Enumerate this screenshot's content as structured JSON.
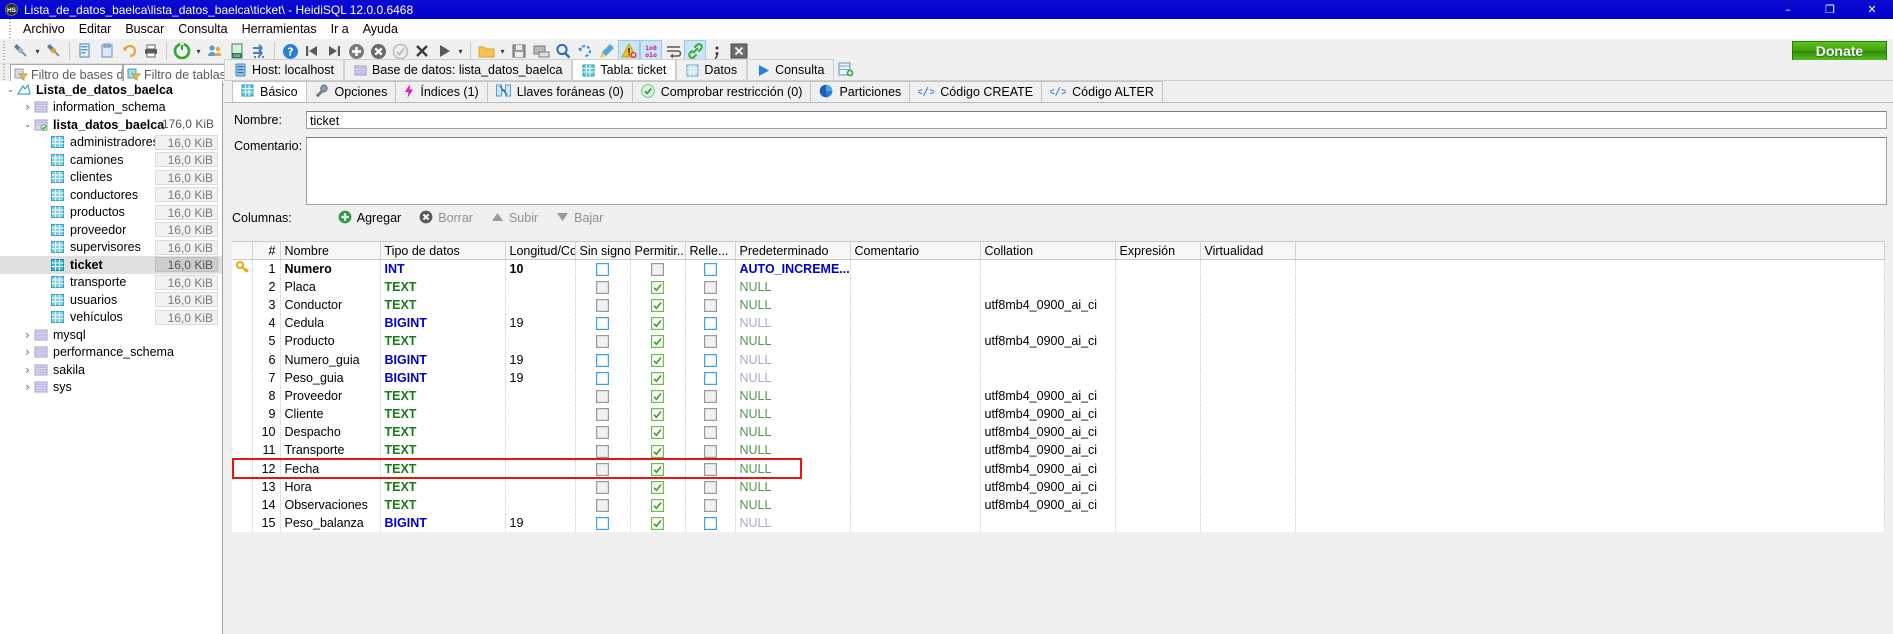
{
  "window": {
    "title": "Lista_de_datos_baelca\\lista_datos_baelca\\ticket\\ - HeidiSQL 12.0.0.6468",
    "logo": "HS",
    "minimize": "–",
    "maximize": "❐",
    "close": "✕"
  },
  "menu": [
    "Archivo",
    "Editar",
    "Buscar",
    "Consulta",
    "Herramientas",
    "Ir a",
    "Ayuda"
  ],
  "toolbar": {
    "donate_label": "Donate",
    "icons": [
      "connect-icon",
      "connect-dropdown-icon",
      "disconnect-icon",
      "new-query-tab-icon",
      "paste-icon",
      "undo-icon",
      "print-icon",
      "refresh-icon",
      "refresh-dropdown-icon",
      "user-manager-icon",
      "export-csv-icon",
      "import-icon",
      "help-icon",
      "first-row-icon",
      "last-row-icon",
      "insert-row-icon",
      "delete-row-icon",
      "commit-icon",
      "cancel-icon",
      "run-query-icon",
      "run-dropdown-icon",
      "open-folder-icon",
      "open-dropdown-icon",
      "save-icon",
      "save-as-icon",
      "find-icon",
      "replace-icon",
      "clear-filter-icon",
      "warning-icon",
      "binary-icon",
      "wrap-icon",
      "link-icon",
      "semicolon-icon",
      "close-tab-icon"
    ]
  },
  "filters": {
    "db_filter_placeholder": "Filtro de bases de datos",
    "table_filter_placeholder": "Filtro de tablas",
    "db_filter_value": "",
    "table_filter_value": ""
  },
  "main_tabs": [
    {
      "label": "Host: localhost",
      "icon": "server-icon",
      "active": false
    },
    {
      "label": "Base de datos: lista_datos_baelca",
      "icon": "database-icon",
      "active": false
    },
    {
      "label": "Tabla: ticket",
      "icon": "table-icon",
      "active": true
    },
    {
      "label": "Datos",
      "icon": "grid-icon",
      "active": false
    },
    {
      "label": "Consulta",
      "icon": "play-icon",
      "active": false
    }
  ],
  "sidebar": {
    "items": [
      {
        "label": "Lista_de_datos_baelca",
        "icon": "session-icon",
        "indent": 0,
        "expander": "down",
        "bold": true,
        "size": "",
        "selected": false
      },
      {
        "label": "information_schema",
        "icon": "db-icon",
        "indent": 1,
        "expander": "right",
        "bold": false,
        "size": "",
        "selected": false
      },
      {
        "label": "lista_datos_baelca",
        "icon": "db-active-icon",
        "indent": 1,
        "expander": "down",
        "bold": true,
        "size": "176,0 KiB",
        "size_plain": true,
        "selected": false
      },
      {
        "label": "administradores",
        "icon": "table-icon",
        "indent": 2,
        "expander": "",
        "bold": false,
        "size": "16,0 KiB",
        "selected": false
      },
      {
        "label": "camiones",
        "icon": "table-icon",
        "indent": 2,
        "expander": "",
        "bold": false,
        "size": "16,0 KiB",
        "selected": false
      },
      {
        "label": "clientes",
        "icon": "table-icon",
        "indent": 2,
        "expander": "",
        "bold": false,
        "size": "16,0 KiB",
        "selected": false
      },
      {
        "label": "conductores",
        "icon": "table-icon",
        "indent": 2,
        "expander": "",
        "bold": false,
        "size": "16,0 KiB",
        "selected": false
      },
      {
        "label": "productos",
        "icon": "table-icon",
        "indent": 2,
        "expander": "",
        "bold": false,
        "size": "16,0 KiB",
        "selected": false
      },
      {
        "label": "proveedor",
        "icon": "table-icon",
        "indent": 2,
        "expander": "",
        "bold": false,
        "size": "16,0 KiB",
        "selected": false
      },
      {
        "label": "supervisores",
        "icon": "table-icon",
        "indent": 2,
        "expander": "",
        "bold": false,
        "size": "16,0 KiB",
        "selected": false
      },
      {
        "label": "ticket",
        "icon": "table-icon",
        "indent": 2,
        "expander": "",
        "bold": true,
        "size": "16,0 KiB",
        "selected": true
      },
      {
        "label": "transporte",
        "icon": "table-icon",
        "indent": 2,
        "expander": "",
        "bold": false,
        "size": "16,0 KiB",
        "selected": false
      },
      {
        "label": "usuarios",
        "icon": "table-icon",
        "indent": 2,
        "expander": "",
        "bold": false,
        "size": "16,0 KiB",
        "selected": false
      },
      {
        "label": "vehículos",
        "icon": "table-icon",
        "indent": 2,
        "expander": "",
        "bold": false,
        "size": "16,0 KiB",
        "selected": false
      },
      {
        "label": "mysql",
        "icon": "db-icon",
        "indent": 1,
        "expander": "right",
        "bold": false,
        "size": "",
        "selected": false
      },
      {
        "label": "performance_schema",
        "icon": "db-icon",
        "indent": 1,
        "expander": "right",
        "bold": false,
        "size": "",
        "selected": false
      },
      {
        "label": "sakila",
        "icon": "db-icon",
        "indent": 1,
        "expander": "right",
        "bold": false,
        "size": "",
        "selected": false
      },
      {
        "label": "sys",
        "icon": "db-icon",
        "indent": 1,
        "expander": "right",
        "bold": false,
        "size": "",
        "selected": false
      }
    ]
  },
  "sub_tabs": [
    {
      "label": "Básico",
      "icon": "table-grid-icon",
      "active": true
    },
    {
      "label": "Opciones",
      "icon": "wrench-icon",
      "active": false
    },
    {
      "label": "Índices (1)",
      "icon": "lightning-icon",
      "active": false
    },
    {
      "label": "Llaves foráneas (0)",
      "icon": "foreign-key-icon",
      "active": false
    },
    {
      "label": "Comprobar restricción (0)",
      "icon": "check-circle-icon",
      "active": false
    },
    {
      "label": "Particiones",
      "icon": "pie-chart-icon",
      "active": false
    },
    {
      "label": "Código CREATE",
      "icon": "code-icon",
      "active": false
    },
    {
      "label": "Código ALTER",
      "icon": "code-icon",
      "active": false
    }
  ],
  "form": {
    "name_label": "Nombre:",
    "name_value": "ticket",
    "comment_label": "Comentario:",
    "comment_value": ""
  },
  "columns_toolbar": {
    "label": "Columnas:",
    "add": "Agregar",
    "delete": "Borrar",
    "up": "Subir",
    "down": "Bajar"
  },
  "grid": {
    "headers": [
      "",
      "#",
      "Nombre",
      "Tipo de datos",
      "Longitud/Co...",
      "Sin signo",
      "Permitir...",
      "Relle...",
      "Predeterminado",
      "Comentario",
      "Collation",
      "Expresión",
      "Virtualidad"
    ],
    "rows": [
      {
        "key": true,
        "num": "1",
        "name": "Numero",
        "type": "INT",
        "type_class": "dtype-int",
        "length": "10",
        "unsigned": "unchecked-blue",
        "nullable": "unchecked-gray",
        "zerofill": "unchecked-blue",
        "default": "AUTO_INCREME...",
        "default_class": "v-auto",
        "comment": "",
        "collation": "",
        "expression": "",
        "virtuality": "",
        "highlight": false
      },
      {
        "key": false,
        "num": "2",
        "name": "Placa",
        "type": "TEXT",
        "type_class": "dtype-text",
        "length": "",
        "unsigned": "unchecked-gray",
        "nullable": "checked-green",
        "zerofill": "unchecked-gray",
        "default": "NULL",
        "default_class": "v-null",
        "comment": "",
        "collation": "",
        "expression": "",
        "virtuality": "",
        "highlight": false
      },
      {
        "key": false,
        "num": "3",
        "name": "Conductor",
        "type": "TEXT",
        "type_class": "dtype-text",
        "length": "",
        "unsigned": "unchecked-gray",
        "nullable": "checked-green",
        "zerofill": "unchecked-gray",
        "default": "NULL",
        "default_class": "v-null",
        "comment": "",
        "collation": "utf8mb4_0900_ai_ci",
        "expression": "",
        "virtuality": "",
        "highlight": false
      },
      {
        "key": false,
        "num": "4",
        "name": "Cedula",
        "type": "BIGINT",
        "type_class": "dtype-int",
        "length": "19",
        "unsigned": "unchecked-blue",
        "nullable": "checked-green",
        "zerofill": "unchecked-blue",
        "default": "NULL",
        "default_class": "v-null pale",
        "comment": "",
        "collation": "",
        "expression": "",
        "virtuality": "",
        "highlight": false
      },
      {
        "key": false,
        "num": "5",
        "name": "Producto",
        "type": "TEXT",
        "type_class": "dtype-text",
        "length": "",
        "unsigned": "unchecked-gray",
        "nullable": "checked-green",
        "zerofill": "unchecked-gray",
        "default": "NULL",
        "default_class": "v-null",
        "comment": "",
        "collation": "utf8mb4_0900_ai_ci",
        "expression": "",
        "virtuality": "",
        "highlight": false
      },
      {
        "key": false,
        "num": "6",
        "name": "Numero_guia",
        "type": "BIGINT",
        "type_class": "dtype-int",
        "length": "19",
        "unsigned": "unchecked-blue",
        "nullable": "checked-green",
        "zerofill": "unchecked-blue",
        "default": "NULL",
        "default_class": "v-null pale",
        "comment": "",
        "collation": "",
        "expression": "",
        "virtuality": "",
        "highlight": false
      },
      {
        "key": false,
        "num": "7",
        "name": "Peso_guia",
        "type": "BIGINT",
        "type_class": "dtype-int",
        "length": "19",
        "unsigned": "unchecked-blue",
        "nullable": "checked-green",
        "zerofill": "unchecked-blue",
        "default": "NULL",
        "default_class": "v-null pale",
        "comment": "",
        "collation": "",
        "expression": "",
        "virtuality": "",
        "highlight": false
      },
      {
        "key": false,
        "num": "8",
        "name": "Proveedor",
        "type": "TEXT",
        "type_class": "dtype-text",
        "length": "",
        "unsigned": "unchecked-gray",
        "nullable": "checked-green",
        "zerofill": "unchecked-gray",
        "default": "NULL",
        "default_class": "v-null",
        "comment": "",
        "collation": "utf8mb4_0900_ai_ci",
        "expression": "",
        "virtuality": "",
        "highlight": false
      },
      {
        "key": false,
        "num": "9",
        "name": "Cliente",
        "type": "TEXT",
        "type_class": "dtype-text",
        "length": "",
        "unsigned": "unchecked-gray",
        "nullable": "checked-green",
        "zerofill": "unchecked-gray",
        "default": "NULL",
        "default_class": "v-null",
        "comment": "",
        "collation": "utf8mb4_0900_ai_ci",
        "expression": "",
        "virtuality": "",
        "highlight": false
      },
      {
        "key": false,
        "num": "10",
        "name": "Despacho",
        "type": "TEXT",
        "type_class": "dtype-text",
        "length": "",
        "unsigned": "unchecked-gray",
        "nullable": "checked-green",
        "zerofill": "unchecked-gray",
        "default": "NULL",
        "default_class": "v-null",
        "comment": "",
        "collation": "utf8mb4_0900_ai_ci",
        "expression": "",
        "virtuality": "",
        "highlight": false
      },
      {
        "key": false,
        "num": "11",
        "name": "Transporte",
        "type": "TEXT",
        "type_class": "dtype-text",
        "length": "",
        "unsigned": "unchecked-gray",
        "nullable": "checked-green",
        "zerofill": "unchecked-gray",
        "default": "NULL",
        "default_class": "v-null",
        "comment": "",
        "collation": "utf8mb4_0900_ai_ci",
        "expression": "",
        "virtuality": "",
        "highlight": false
      },
      {
        "key": false,
        "num": "12",
        "name": "Fecha",
        "type": "TEXT",
        "type_class": "dtype-text",
        "length": "",
        "unsigned": "unchecked-gray",
        "nullable": "checked-green",
        "zerofill": "unchecked-gray",
        "default": "NULL",
        "default_class": "v-null",
        "comment": "",
        "collation": "utf8mb4_0900_ai_ci",
        "expression": "",
        "virtuality": "",
        "highlight": true
      },
      {
        "key": false,
        "num": "13",
        "name": "Hora",
        "type": "TEXT",
        "type_class": "dtype-text",
        "length": "",
        "unsigned": "unchecked-gray",
        "nullable": "checked-green",
        "zerofill": "unchecked-gray",
        "default": "NULL",
        "default_class": "v-null",
        "comment": "",
        "collation": "utf8mb4_0900_ai_ci",
        "expression": "",
        "virtuality": "",
        "highlight": false
      },
      {
        "key": false,
        "num": "14",
        "name": "Observaciones",
        "type": "TEXT",
        "type_class": "dtype-text",
        "length": "",
        "unsigned": "unchecked-gray",
        "nullable": "checked-green",
        "zerofill": "unchecked-gray",
        "default": "NULL",
        "default_class": "v-null",
        "comment": "",
        "collation": "utf8mb4_0900_ai_ci",
        "expression": "",
        "virtuality": "",
        "highlight": false
      },
      {
        "key": false,
        "num": "15",
        "name": "Peso_balanza",
        "type": "BIGINT",
        "type_class": "dtype-int",
        "length": "19",
        "unsigned": "unchecked-blue",
        "nullable": "checked-green",
        "zerofill": "unchecked-blue",
        "default": "NULL",
        "default_class": "v-null pale",
        "comment": "",
        "collation": "",
        "expression": "",
        "virtuality": "",
        "highlight": false
      }
    ]
  },
  "colors": {
    "titlebar": "#0000cd",
    "donate": "#3da10c",
    "highlight_box": "#ee1111",
    "selection": "#e0e0e0",
    "datatype_numeric": "#0000cd",
    "datatype_text": "#1a7a1a"
  }
}
